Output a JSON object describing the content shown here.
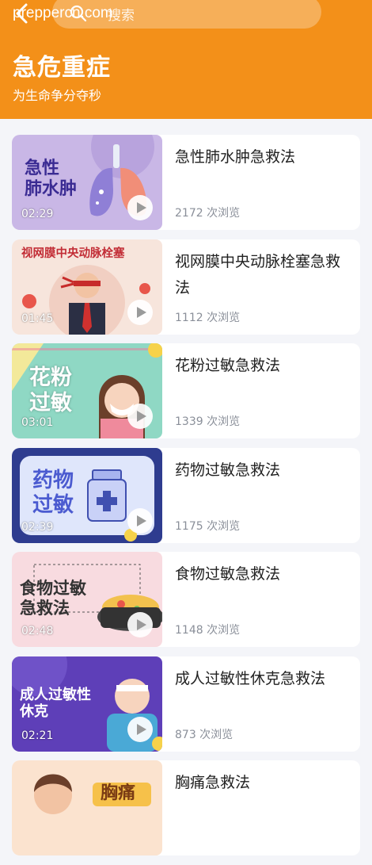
{
  "header": {
    "watermark": "preppercn.com",
    "search_placeholder": "搜索",
    "title": "急危重症",
    "subtitle": "为生命争分夺秒",
    "bg_color": "#f39019"
  },
  "videos": [
    {
      "title": "急性肺水肿急救法",
      "thumb_text": "急性\n肺水肿",
      "duration": "02:29",
      "views": "2172 次浏览"
    },
    {
      "title": "视网膜中央动脉栓塞急救法",
      "thumb_text": "视网膜中央动脉栓塞",
      "duration": "01:45",
      "views": "1112 次浏览"
    },
    {
      "title": "花粉过敏急救法",
      "thumb_text": "花粉\n过敏",
      "duration": "03:01",
      "views": "1339 次浏览"
    },
    {
      "title": "药物过敏急救法",
      "thumb_text": "药物\n过敏",
      "duration": "02:39",
      "views": "1175 次浏览"
    },
    {
      "title": "食物过敏急救法",
      "thumb_text": "食物过敏\n急救法",
      "duration": "02:48",
      "views": "1148 次浏览"
    },
    {
      "title": "成人过敏性休克急救法",
      "thumb_text": "成人过敏性\n休克",
      "duration": "02:21",
      "views": "873 次浏览"
    },
    {
      "title": "胸痛急救法",
      "thumb_text": "胸痛",
      "duration": "",
      "views": ""
    }
  ]
}
